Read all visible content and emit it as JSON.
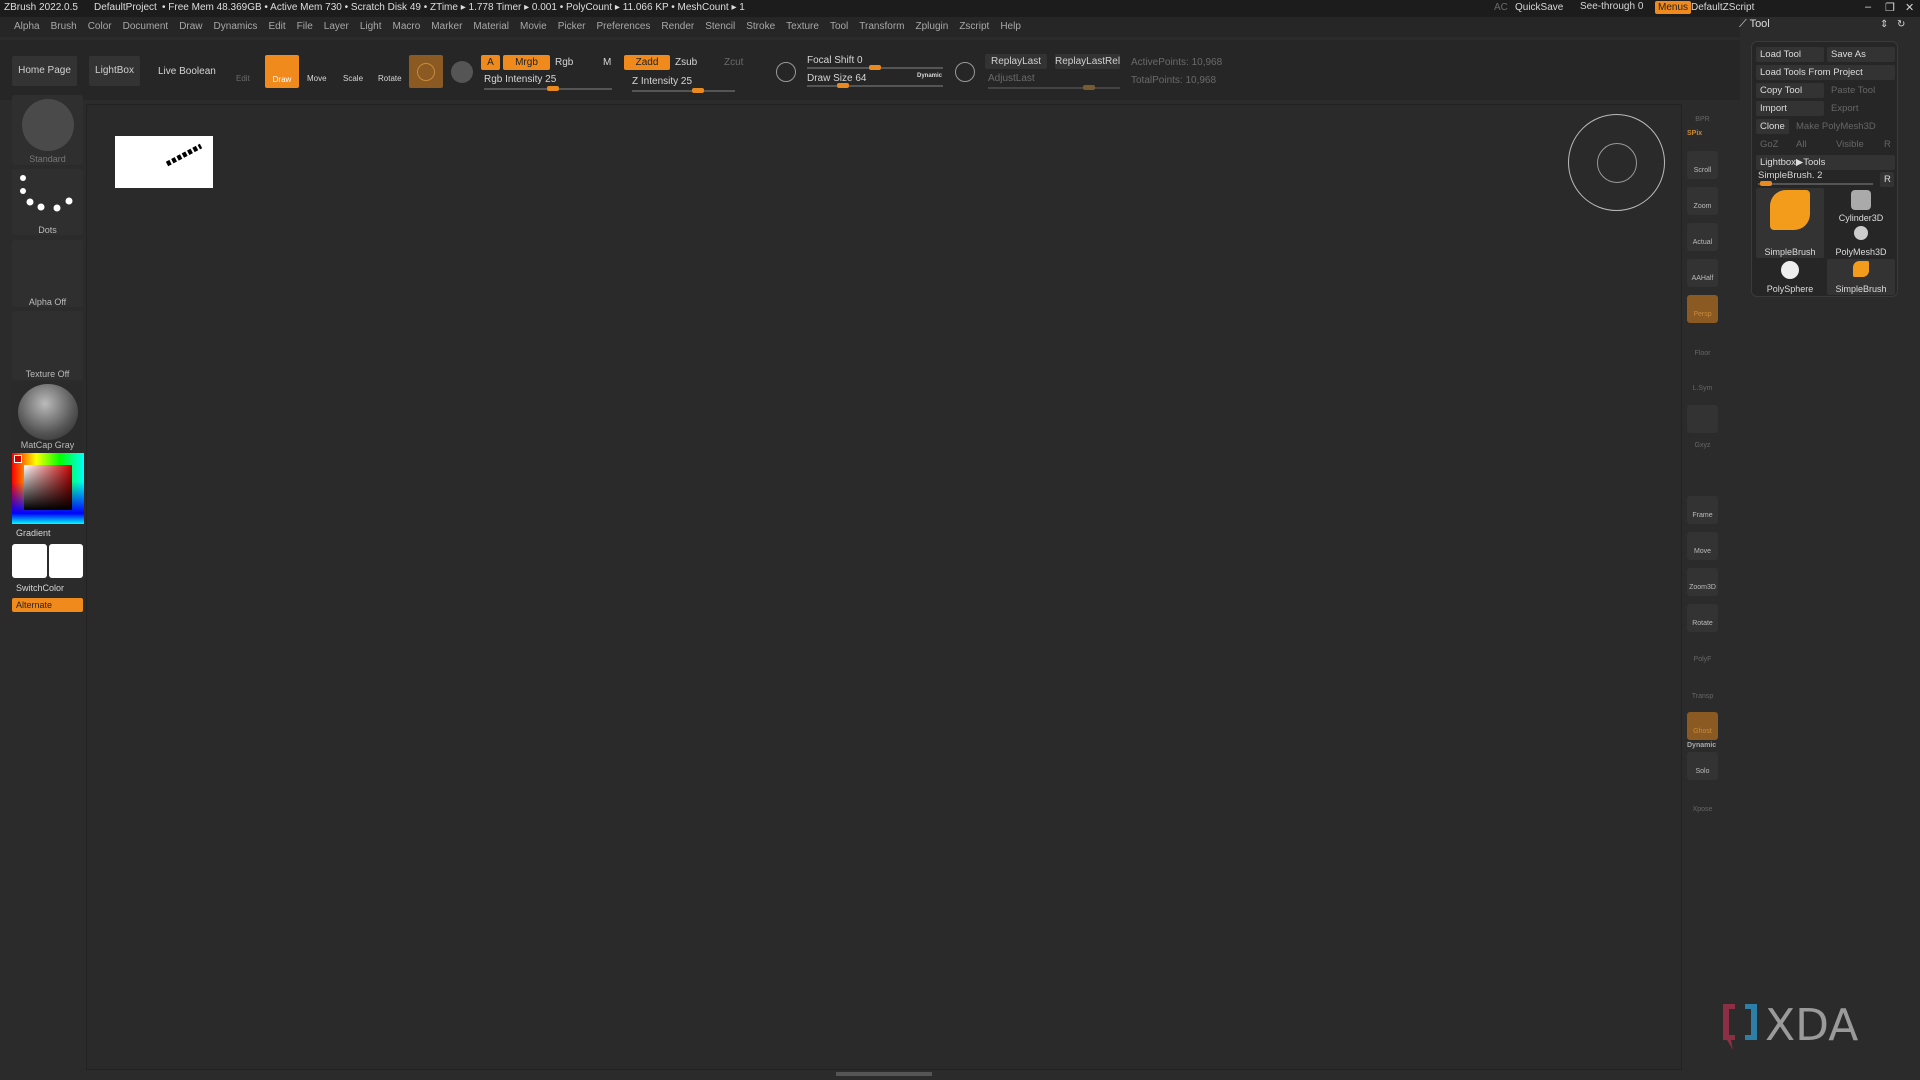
{
  "titlebar": {
    "app": "ZBrush 2022.0.5",
    "project": "DefaultProject",
    "stats": "• Free Mem 48.369GB • Active Mem 730 • Scratch Disk 49 •  ZTime ▸ 1.778 Timer ▸ 0.001 • PolyCount ▸ 11.066 KP  • MeshCount ▸ 1",
    "ac": "AC",
    "quicksave": "QuickSave",
    "seethrough": "See-through  0",
    "menus": "Menus",
    "script": "DefaultZScript"
  },
  "menus": [
    "Alpha",
    "Brush",
    "Color",
    "Document",
    "Draw",
    "Dynamics",
    "Edit",
    "File",
    "Layer",
    "Light",
    "Macro",
    "Marker",
    "Material",
    "Movie",
    "Picker",
    "Preferences",
    "Render",
    "Stencil",
    "Stroke",
    "Texture",
    "Tool",
    "Transform",
    "Zplugin",
    "Zscript",
    "Help"
  ],
  "toolbar": {
    "home": "Home Page",
    "lightbox": "LightBox",
    "liveboolean": "Live Boolean",
    "edit": "Edit",
    "draw": "Draw",
    "move": "Move",
    "scale": "Scale",
    "rotate": "Rotate",
    "a": "A",
    "mrgb": "Mrgb",
    "rgb": "Rgb",
    "m": "M",
    "zadd": "Zadd",
    "zsub": "Zsub",
    "zcut": "Zcut",
    "rgb_intensity": "Rgb Intensity 25",
    "z_intensity": "Z Intensity 25",
    "focal_shift": "Focal Shift 0",
    "draw_size": "Draw Size 64",
    "dynamic": "Dynamic",
    "replaylast": "ReplayLast",
    "replaylastrel": "ReplayLastRel",
    "adjustlast": "AdjustLast",
    "activepoints": "ActivePoints: 10,968",
    "totalpoints": "TotalPoints: 10,968",
    "rgb_intensity_value": 25,
    "z_intensity_value": 25,
    "focal_shift_value": 0,
    "draw_size_value": 64
  },
  "leftshelf": {
    "brush": "Standard",
    "stroke": "Dots",
    "alpha": "Alpha Off",
    "texture": "Texture Off",
    "material": "MatCap Gray",
    "gradient": "Gradient",
    "switchcolor": "SwitchColor",
    "alternate": "Alternate"
  },
  "rightshelf": [
    "BPR",
    "SPix",
    "Scroll",
    "Zoom",
    "Actual",
    "AAHalf",
    "Persp",
    "Floor",
    "L.Sym",
    "",
    "Gxyz",
    "",
    "",
    "Frame",
    "Move",
    "Zoom3D",
    "Rotate",
    "PolyF",
    "Transp",
    "Ghost",
    "Dynamic",
    "Solo",
    "Xpose"
  ],
  "toolpanel": {
    "title": "Tool",
    "load": "Load Tool",
    "saveas": "Save As",
    "loadproject": "Load Tools From Project",
    "copy": "Copy Tool",
    "paste": "Paste Tool",
    "import": "Import",
    "export": "Export",
    "clone": "Clone",
    "makepoly": "Make PolyMesh3D",
    "goz": "GoZ",
    "all": "All",
    "visible": "Visible",
    "r": "R",
    "lightboxtools": "Lightbox▶Tools",
    "current": "SimpleBrush. 2",
    "items": [
      "SimpleBrush",
      "Cylinder3D",
      "PolyMesh3D",
      "PolySphere",
      "SimpleBrush"
    ]
  },
  "watermark": "XDA",
  "colors": {
    "accent": "#f08a1c",
    "bg": "#2b2b2b"
  }
}
